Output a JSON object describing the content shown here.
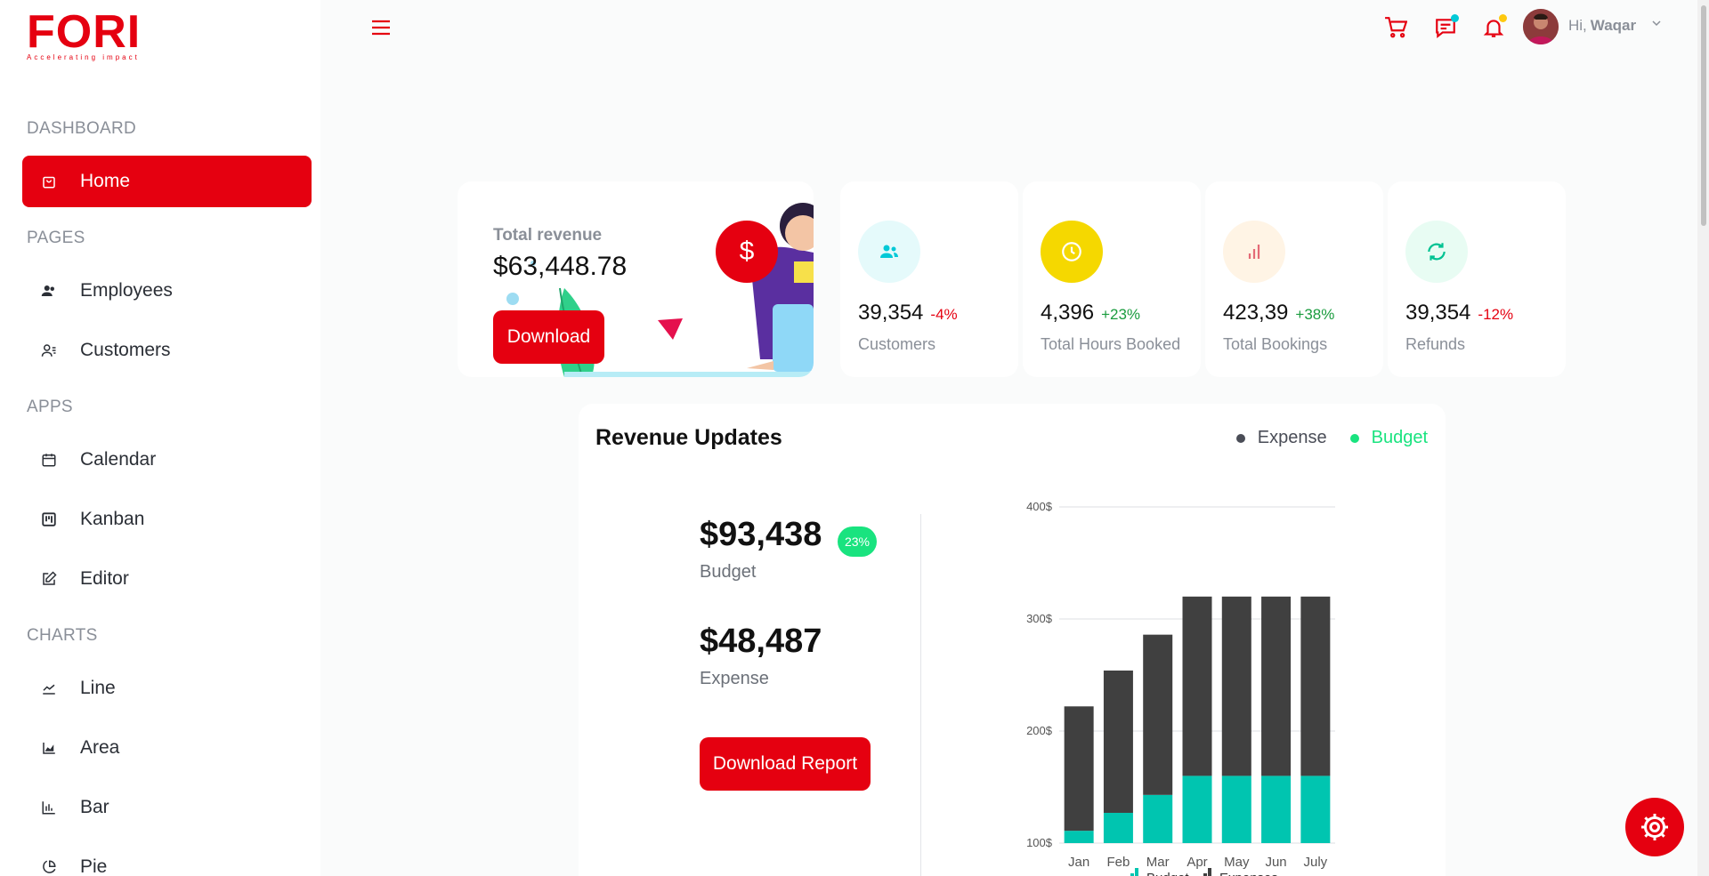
{
  "brand": {
    "logo": "FORI",
    "tagline": "Accelerating impact",
    "accent": "#e50010"
  },
  "sidebar": {
    "sections": [
      {
        "label": "DASHBOARD"
      },
      {
        "label": "PAGES"
      },
      {
        "label": "APPS"
      },
      {
        "label": "CHARTS"
      }
    ],
    "items": [
      {
        "label": "Home",
        "icon": "shopping-bag-icon",
        "active": true
      },
      {
        "label": "Employees",
        "icon": "users-icon"
      },
      {
        "label": "Customers",
        "icon": "customers-icon"
      },
      {
        "label": "Calendar",
        "icon": "calendar-icon"
      },
      {
        "label": "Kanban",
        "icon": "kanban-icon"
      },
      {
        "label": "Editor",
        "icon": "edit-icon"
      },
      {
        "label": "Line",
        "icon": "line-chart-icon"
      },
      {
        "label": "Area",
        "icon": "area-chart-icon"
      },
      {
        "label": "Bar",
        "icon": "bar-chart-icon"
      },
      {
        "label": "Pie",
        "icon": "pie-chart-icon"
      }
    ]
  },
  "topbar": {
    "greeting": "Hi,",
    "user_name": "Waqar",
    "icons": [
      "cart-icon",
      "chat-icon",
      "bell-icon"
    ],
    "chat_dot_color": "#03c9d7",
    "bell_dot_color": "#fec90f"
  },
  "revenue_card": {
    "title": "Total revenue",
    "value": "$63,448.78",
    "button": "Download",
    "badge": "$"
  },
  "stats": [
    {
      "value": "39,354",
      "change": "-4%",
      "change_color": "#e50010",
      "label": "Customers",
      "icon": "customers-icon",
      "icon_color": "#03c9d7",
      "icon_bg": "#e5fafb"
    },
    {
      "value": "4,396",
      "change": "+23%",
      "change_color": "#1a9c3e",
      "label": "Total Hours Booked",
      "icon": "clock-icon",
      "icon_color": "#ffffff",
      "icon_bg": "#f5d800"
    },
    {
      "value": "423,39",
      "change": "+38%",
      "change_color": "#1a9c3e",
      "label": "Total Bookings",
      "icon": "bar-chart-icon",
      "icon_color": "#e46a76",
      "icon_bg": "#fff4e5"
    },
    {
      "value": "39,354",
      "change": "-12%",
      "change_color": "#e50010",
      "label": "Refunds",
      "icon": "refresh-icon",
      "icon_color": "#00c292",
      "icon_bg": "#e8fcf3"
    }
  ],
  "revenue_updates": {
    "title": "Revenue Updates",
    "legend": [
      {
        "label": "Expense",
        "color": "#4a4d57"
      },
      {
        "label": "Budget",
        "color": "#19e37f"
      }
    ],
    "budget_value": "$93,438",
    "budget_label": "Budget",
    "budget_change": "23%",
    "expense_value": "$48,487",
    "expense_label": "Expense",
    "report_button": "Download Report"
  },
  "chart_data": {
    "type": "bar",
    "stacked": true,
    "categories": [
      "Jan",
      "Feb",
      "Mar",
      "Apr",
      "May",
      "Jun",
      "July"
    ],
    "series": [
      {
        "name": "Budget",
        "color": "#00c5b0",
        "values": [
          111,
          127,
          143,
          160,
          160,
          160,
          160
        ]
      },
      {
        "name": "Expenses",
        "color": "#404040",
        "values": [
          111,
          127,
          143,
          160,
          160,
          160,
          160
        ]
      }
    ],
    "ylim": [
      100,
      400
    ],
    "yticks": [
      "100$",
      "200$",
      "300$",
      "400$"
    ],
    "grid": true,
    "legend": "bottom"
  }
}
